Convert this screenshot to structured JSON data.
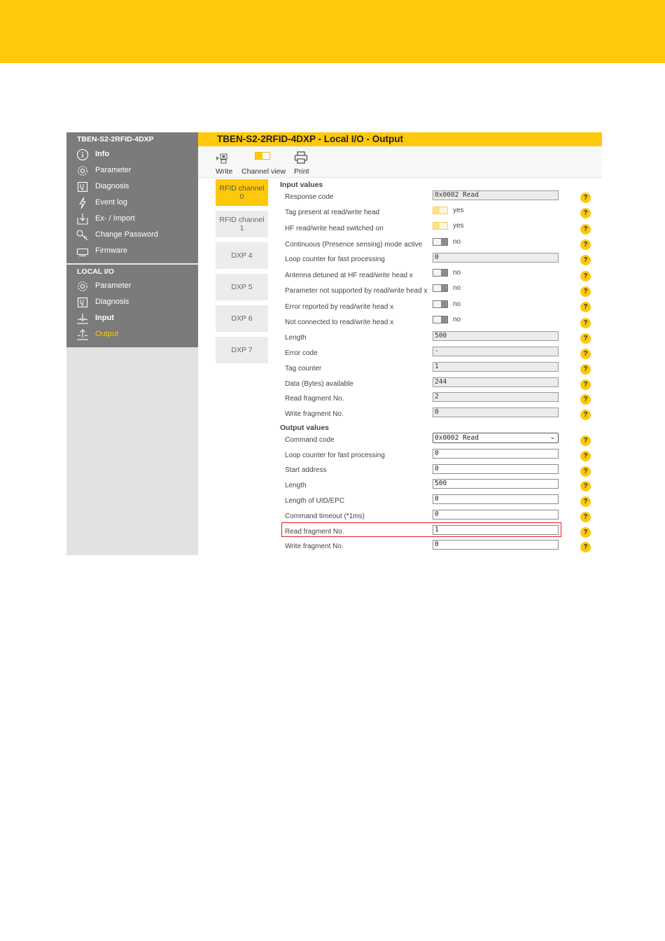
{
  "colors": {
    "brand_yellow": "#fec80b",
    "sidebar_gray": "#7b7b7b",
    "highlight_red": "#e01e1e"
  },
  "sidebar": {
    "device_name": "TBEN-S2-2RFID-4DXP",
    "items": [
      {
        "label": "Info",
        "icon": "info-icon"
      },
      {
        "label": "Parameter",
        "icon": "gear-icon"
      },
      {
        "label": "Diagnosis",
        "icon": "stethoscope-icon"
      },
      {
        "label": "Event log",
        "icon": "lightning-icon"
      },
      {
        "label": "Ex- / Import",
        "icon": "import-icon"
      },
      {
        "label": "Change Password",
        "icon": "key-icon"
      },
      {
        "label": "Firmware",
        "icon": "device-icon"
      }
    ],
    "local_io_title": "LOCAL I/O",
    "local_io_items": [
      {
        "label": "Parameter",
        "icon": "gear-icon"
      },
      {
        "label": "Diagnosis",
        "icon": "stethoscope-icon"
      },
      {
        "label": "Input",
        "icon": "input-icon"
      },
      {
        "label": "Output",
        "icon": "output-icon",
        "active": true
      }
    ]
  },
  "main": {
    "title": "TBEN-S2-2RFID-4DXP - Local I/O - Output",
    "toolbar": {
      "write": "Write",
      "channel_view": "Channel view",
      "print": "Print"
    },
    "tabs": [
      {
        "line1": "RFID channel",
        "line2": "0",
        "active": true
      },
      {
        "line1": "RFID channel",
        "line2": "1"
      },
      {
        "line1": "DXP 4"
      },
      {
        "line1": "DXP 5"
      },
      {
        "line1": "DXP 6"
      },
      {
        "line1": "DXP 7"
      }
    ],
    "input_title": "Input values",
    "input_rows": [
      {
        "label": "Response code",
        "value": "0x0002 Read"
      },
      {
        "label": "Tag present at read/write head",
        "toggle": "yes"
      },
      {
        "label": "HF read/write head switched on",
        "toggle": "yes"
      },
      {
        "label": "Continuous (Presence sensing) mode active",
        "toggle": "no"
      },
      {
        "label": "Loop counter for fast processing",
        "value": "0"
      },
      {
        "label": "Antenna detuned at HF read/write head x",
        "toggle": "no"
      },
      {
        "label": "Parameter not supported by read/write head x",
        "toggle": "no"
      },
      {
        "label": "Error reported by read/write head x",
        "toggle": "no"
      },
      {
        "label": "Not connected to read/write head x",
        "toggle": "no"
      },
      {
        "label": "Length",
        "value": "500"
      },
      {
        "label": "Error code",
        "value": "-"
      },
      {
        "label": "Tag counter",
        "value": "1"
      },
      {
        "label": "Data (Bytes) available",
        "value": "244"
      },
      {
        "label": "Read fragment No.",
        "value": "2"
      },
      {
        "label": "Write fragment No.",
        "value": "0"
      }
    ],
    "output_title": "Output values",
    "output_rows": [
      {
        "label": "Command code",
        "value": "0x0002 Read"
      },
      {
        "label": "Loop counter for fast processing",
        "value": "0"
      },
      {
        "label": "Start address",
        "value": "0"
      },
      {
        "label": "Length",
        "value": "500"
      },
      {
        "label": "Length of UID/EPC",
        "value": "0"
      },
      {
        "label": "Command timeout (*1ms)",
        "value": "0"
      },
      {
        "label": "Read fragment No.",
        "value": "1"
      },
      {
        "label": "Write fragment No.",
        "value": "0"
      }
    ],
    "help_glyph": "?"
  }
}
